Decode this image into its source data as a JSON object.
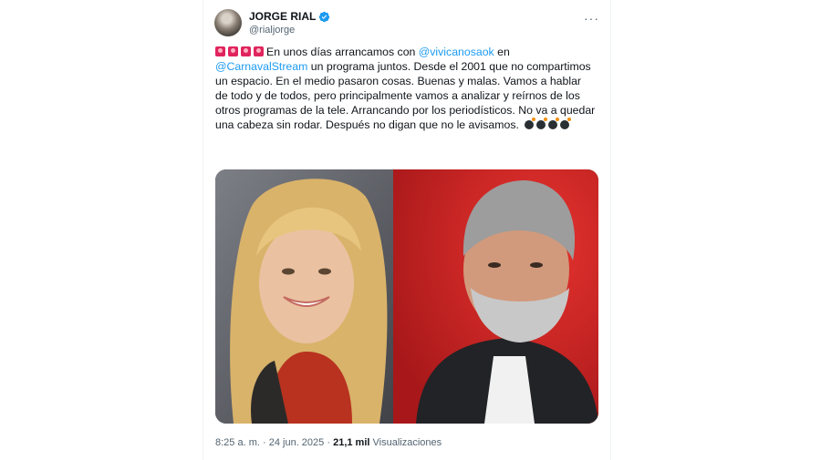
{
  "tweet": {
    "author": {
      "name": "JORGE RIAL",
      "handle": "@rialjorge",
      "verified_badge": "verified-check-icon"
    },
    "more_icon": "more-horizontal-icon",
    "text_parts": {
      "lead_emojis": "siren-emoji",
      "part1": "En unos días arrancamos con ",
      "mention1": "@vivicanosaok",
      "part2": " en ",
      "mention2": "@CarnavalStream",
      "part3": " un programa juntos. Desde el 2001 que no compartimos un espacio. En el medio pasaron cosas. Buenas y malas. Vamos a hablar de todo y de todos, pero principalmente vamos a analizar y reírnos de los otros programas de la tele. Arrancando por los periodísticos. No va a quedar una cabeza sin rodar. Después no digan que no le avisamos.",
      "trail_emojis": "bomb-emoji"
    },
    "media": {
      "icon": "photo-of-two-people",
      "colors": {
        "left_bg": "#5a5d63",
        "right_bg": "#d42a2a"
      }
    },
    "time": "8:25 a. m.",
    "separator": "·",
    "date": "24 jun. 2025",
    "views_count": "21,1 mil",
    "views_label": "Visualizaciones"
  },
  "colors": {
    "link": "#1d9bf0",
    "text": "#0f1419",
    "muted": "#536471"
  }
}
